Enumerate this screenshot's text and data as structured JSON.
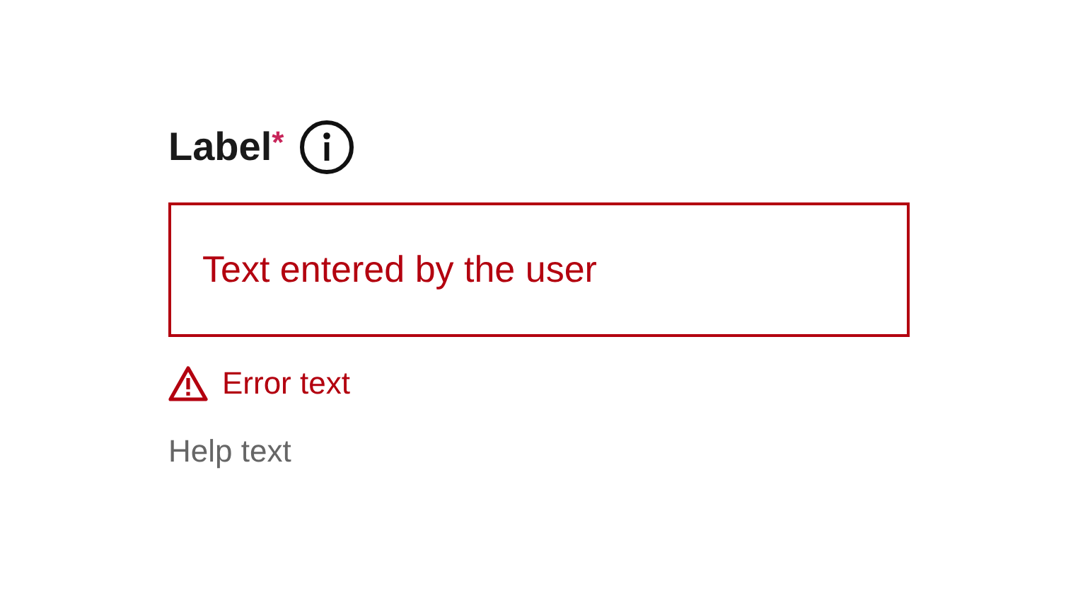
{
  "field": {
    "label": "Label",
    "required_mark": "*",
    "value": "Text entered by the user",
    "error": true,
    "error_text": "Error text",
    "help_text": "Help text"
  }
}
